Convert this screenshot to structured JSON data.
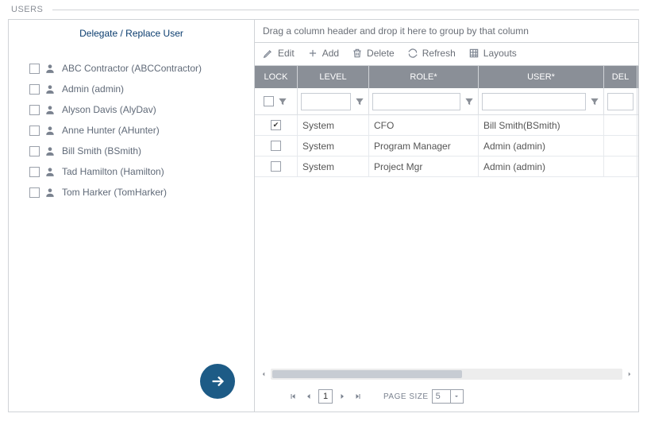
{
  "section_title": "USERS",
  "left": {
    "title": "Delegate / Replace User",
    "users": [
      "ABC Contractor (ABCContractor)",
      "Admin (admin)",
      "Alyson Davis (AlyDav)",
      "Anne Hunter (AHunter)",
      "Bill Smith (BSmith)",
      "Tad Hamilton (Hamilton)",
      "Tom Harker (TomHarker)"
    ]
  },
  "group_hint": "Drag a column header and drop it here to group by that column",
  "toolbar": {
    "edit": "Edit",
    "add": "Add",
    "delete": "Delete",
    "refresh": "Refresh",
    "layouts": "Layouts"
  },
  "columns": {
    "lock": "LOCK",
    "level": "LEVEL",
    "role": "ROLE*",
    "user": "USER*",
    "del": "DEL"
  },
  "rows": [
    {
      "locked": true,
      "level": "System",
      "role": "CFO",
      "user": "Bill Smith(BSmith)"
    },
    {
      "locked": false,
      "level": "System",
      "role": "Program Manager",
      "user": "Admin (admin)"
    },
    {
      "locked": false,
      "level": "System",
      "role": "Project Mgr",
      "user": "Admin (admin)"
    }
  ],
  "pager": {
    "page": "1",
    "page_size_label": "PAGE SIZE",
    "page_size": "5"
  }
}
